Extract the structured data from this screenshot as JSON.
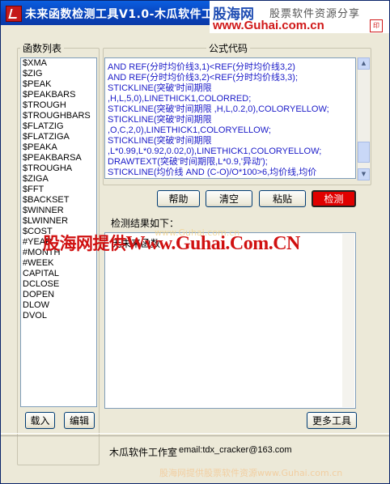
{
  "window": {
    "title": "未来函数检测工具V1.0-木瓜软件工作"
  },
  "watermark": {
    "logo": "股海网",
    "tagline": "股票软件资源分享",
    "url": "www.Guhai.com.cn",
    "overlay_cn": "股海网提供",
    "overlay_url": "Www.Guhai.Com.CN",
    "faint_text": "www.Guhai.com.cn",
    "bottom_text": "股海网提供股票软件资源www.Guhai.com.cn"
  },
  "function_list": {
    "label": "函数列表",
    "items": [
      "$XMA",
      "$ZIG",
      "$PEAK",
      "$PEAKBARS",
      "$TROUGH",
      "$TROUGHBARS",
      "$FLATZIG",
      "$FLATZIGA",
      "$PEAKA",
      "$PEAKBARSA",
      "$TROUGHA",
      "$ZIGA",
      "$FFT",
      "$BACKSET",
      "$WINNER",
      "$LWINNER",
      "$COST",
      "#YEAR",
      "#MONTH",
      "#WEEK",
      "CAPITAL",
      "DCLOSE",
      "DOPEN",
      "DLOW",
      "DVOL"
    ]
  },
  "code_panel": {
    "label": "公式代码",
    "lines": [
      "AND REF(分时均价线3,1)<REF(分时均价线3,2)",
      "AND  REF(分时均价线3,2)<REF(分时均价线3,3);",
      "STICKLINE(突破'时间期限",
      ",H,L,5,0),LINETHICK1,COLORRED;",
      "STICKLINE(突破'时间期限 ,H,L,0.2,0),COLORYELLOW;",
      "STICKLINE(突破'时间期限",
      ",O,C,2,0),LINETHICK1,COLORYELLOW;",
      "STICKLINE(突破'时间期限",
      ",L*0.99,L*0.92,0.02,0),LINETHICK1,COLORYELLOW;",
      "DRAWTEXT(突破'时间期限,L*0.9,'异动');",
      "STICKLINE(均价线 AND (C-O)/O*100>6,均价线,均价"
    ]
  },
  "buttons": {
    "help": "帮助",
    "clear": "清空",
    "paste": "粘贴",
    "check": "检测",
    "load": "载入",
    "edit": "编辑",
    "more_tools": "更多工具"
  },
  "result_panel": {
    "label": "检测结果如下：",
    "text": "无未来函数"
  },
  "footer": {
    "studio": "木瓜软件工作室",
    "email": "email:tdx_cracker@163.com"
  },
  "colors": {
    "title_bar": "#0841b8",
    "check_button": "#e00000",
    "code_text": "#1a1ac8"
  }
}
